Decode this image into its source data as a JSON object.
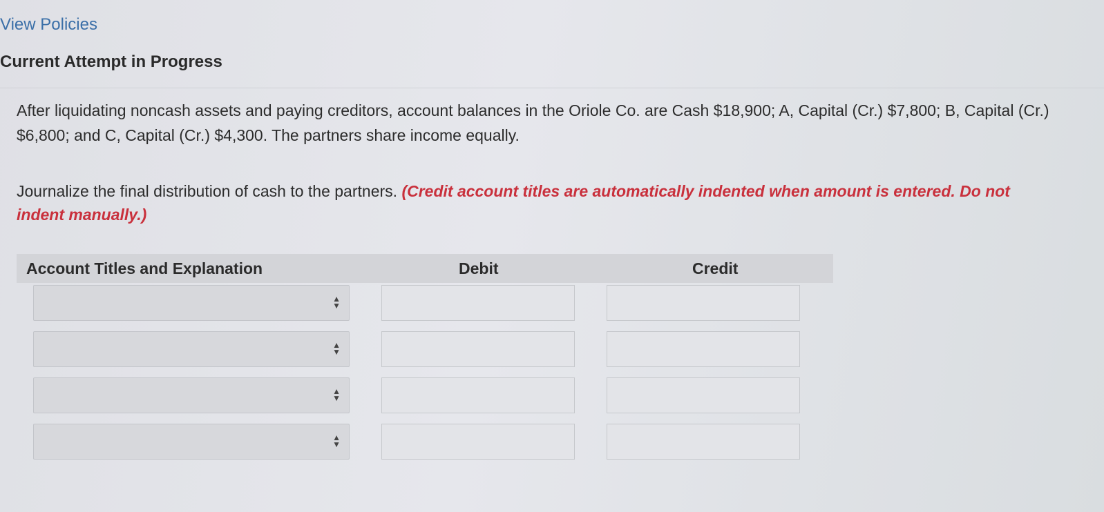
{
  "header": {
    "view_policies": "View Policies",
    "attempt_title": "Current Attempt in Progress"
  },
  "question": {
    "text": "After liquidating noncash assets and paying creditors, account balances in the Oriole Co. are Cash $18,900; A, Capital (Cr.) $7,800; B, Capital (Cr.) $6,800; and C, Capital (Cr.) $4,300. The partners share income equally."
  },
  "instruction": {
    "text": "Journalize the final distribution of cash to the partners.",
    "note": "(Credit account titles are automatically indented when amount is entered. Do not indent manually.)"
  },
  "table": {
    "headers": {
      "account": "Account Titles and Explanation",
      "debit": "Debit",
      "credit": "Credit"
    },
    "rows": [
      {
        "account": "",
        "debit": "",
        "credit": ""
      },
      {
        "account": "",
        "debit": "",
        "credit": ""
      },
      {
        "account": "",
        "debit": "",
        "credit": ""
      },
      {
        "account": "",
        "debit": "",
        "credit": ""
      }
    ],
    "select_icon": "up-down-arrows-icon"
  }
}
